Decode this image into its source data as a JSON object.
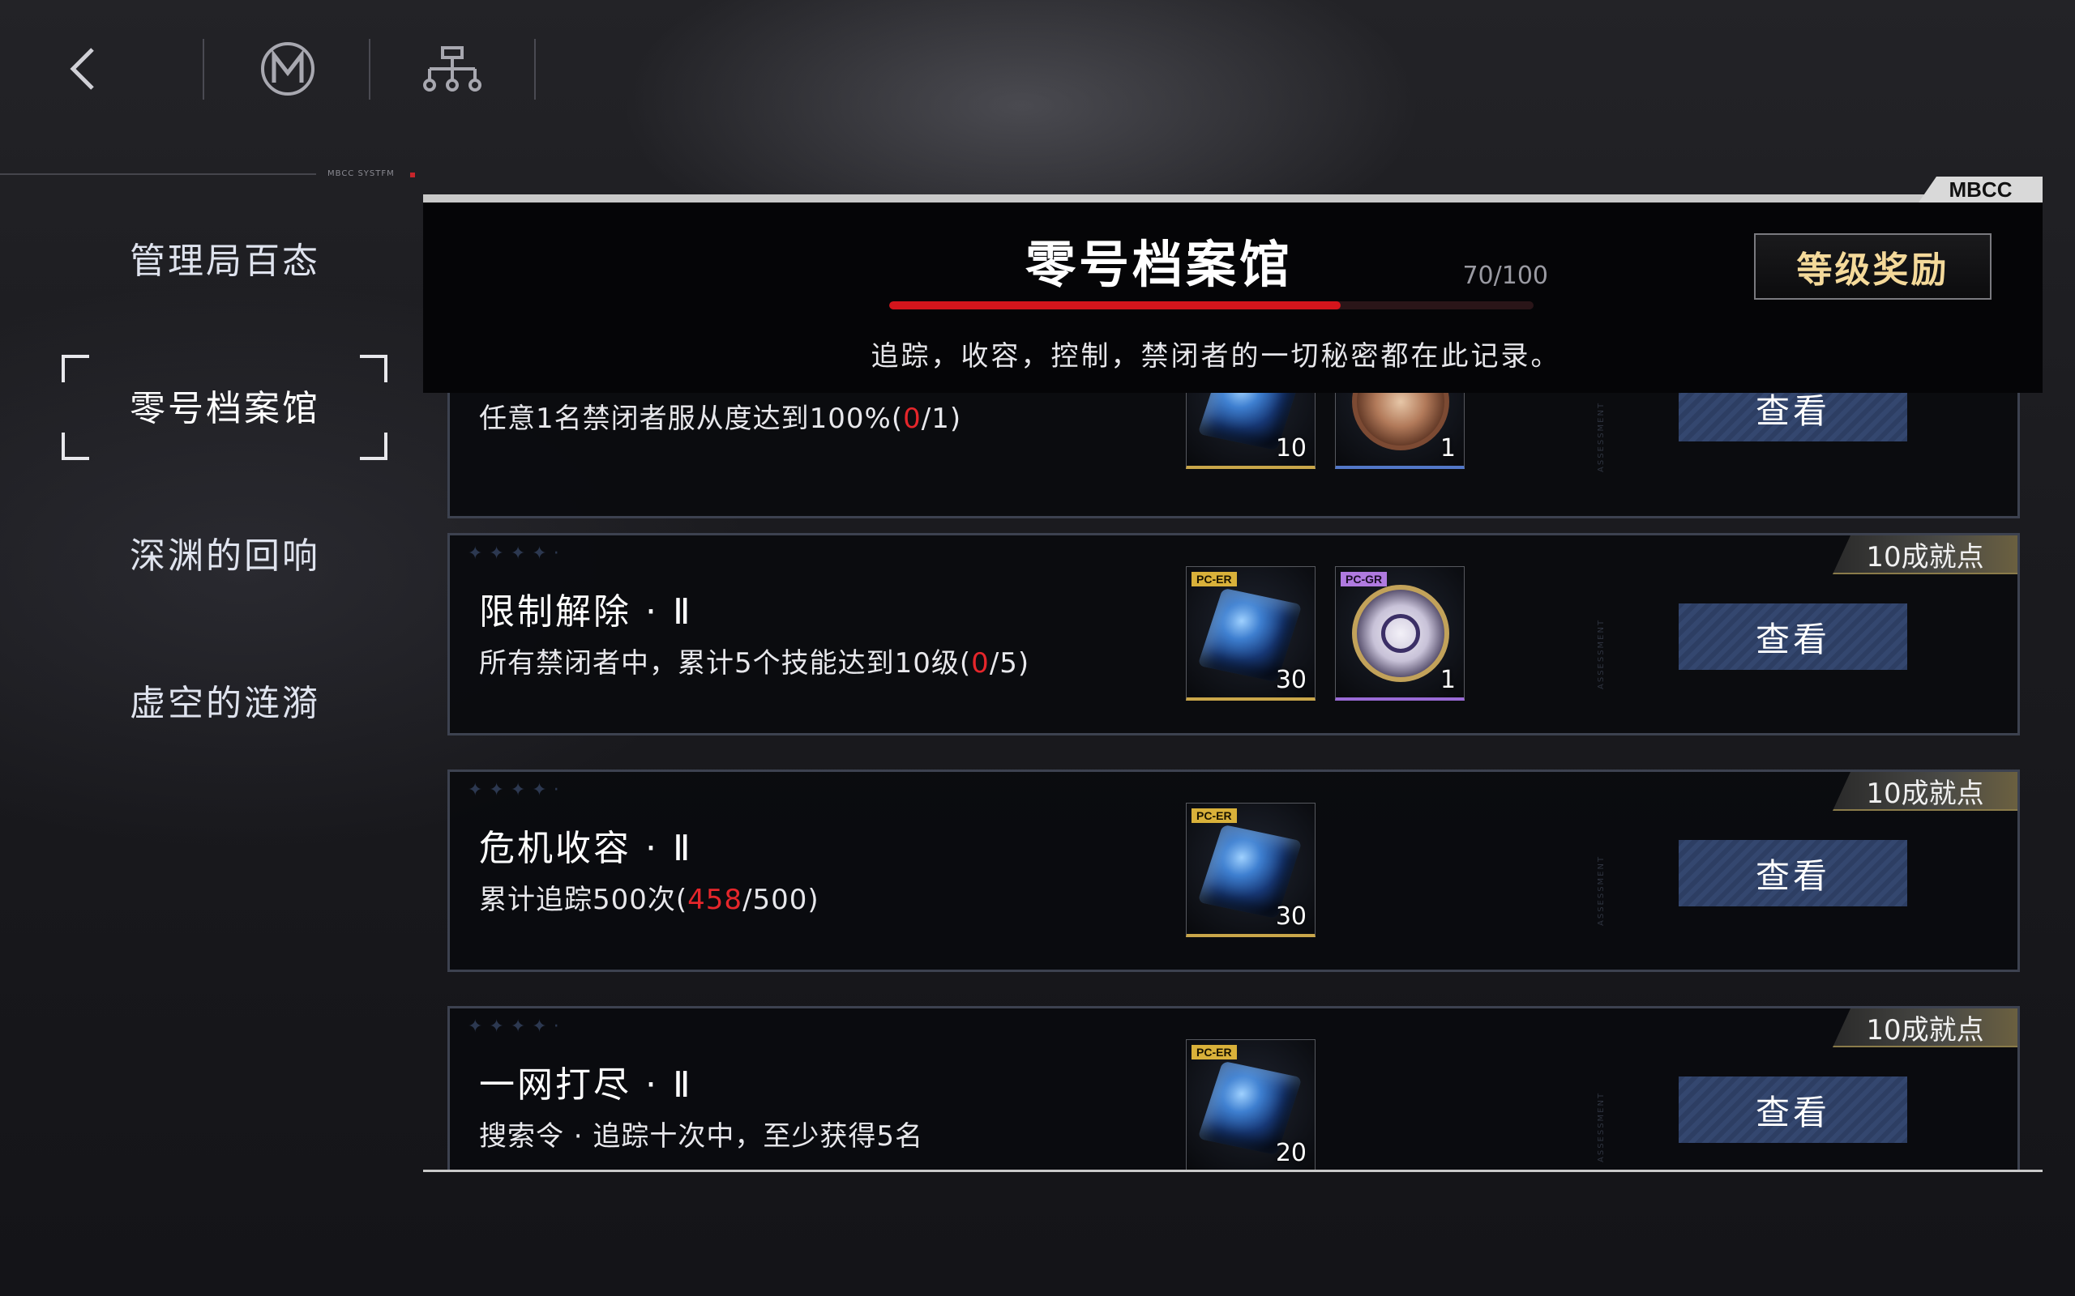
{
  "topbar": {
    "back_icon": "chevron-left-icon",
    "logo_icon": "m-emblem-icon",
    "hierarchy_icon": "org-chart-icon"
  },
  "sidebar": {
    "system_tag": "MBCC SYSTFM",
    "items": [
      {
        "label": "管理局百态",
        "active": false
      },
      {
        "label": "零号档案馆",
        "active": true
      },
      {
        "label": "深渊的回响",
        "active": false
      },
      {
        "label": "虚空的涟漪",
        "active": false
      }
    ]
  },
  "panel": {
    "corner_tag": "MBCC",
    "title": "零号档案馆",
    "progress_text": "70/100",
    "progress_value": 70,
    "progress_max": 100,
    "subtitle": "追踪，收容，控制，禁闭者的一切秘密都在此记录。",
    "level_reward_button": "等级奖励"
  },
  "tasks": [
    {
      "title": "",
      "desc_prefix": "任意1名禁闭者服从度达到100%(",
      "progress_current": "0",
      "progress_suffix": "/1)",
      "badge": "",
      "rewards": [
        {
          "type": "cube",
          "tag": "",
          "qty": "10",
          "rarity": "gold"
        },
        {
          "type": "medal-bronze",
          "tag": "",
          "qty": "1",
          "rarity": "blue"
        }
      ],
      "assess_label": "ASSESSMENT",
      "button": "查看"
    },
    {
      "title": "限制解除 · Ⅱ",
      "desc_prefix": "所有禁闭者中，累计5个技能达到10级(",
      "progress_current": "0",
      "progress_suffix": "/5)",
      "badge": "10成就点",
      "rewards": [
        {
          "type": "cube",
          "tag": "PC-ER",
          "qty": "30",
          "rarity": "gold"
        },
        {
          "type": "medal-silver",
          "tag": "PC-GR",
          "qty": "1",
          "rarity": "purple"
        }
      ],
      "assess_label": "ASSESSMENT",
      "button": "查看"
    },
    {
      "title": "危机收容 · Ⅱ",
      "desc_prefix": "累计追踪500次(",
      "progress_current": "458",
      "progress_suffix": "/500)",
      "badge": "10成就点",
      "rewards": [
        {
          "type": "cube",
          "tag": "PC-ER",
          "qty": "30",
          "rarity": "gold"
        }
      ],
      "assess_label": "ASSESSMENT",
      "button": "查看"
    },
    {
      "title": "一网打尽 · Ⅱ",
      "desc_prefix": "搜索令 · 追踪十次中，至少获得5名",
      "progress_current": "",
      "progress_suffix": "",
      "badge": "10成就点",
      "rewards": [
        {
          "type": "cube",
          "tag": "PC-ER",
          "qty": "20",
          "rarity": "gold"
        }
      ],
      "assess_label": "ASSESSMENT",
      "button": "查看"
    }
  ],
  "colors": {
    "accent_red": "#d4151c",
    "gold_text": "#f4d99a",
    "button_blue": "#2d3e63"
  }
}
